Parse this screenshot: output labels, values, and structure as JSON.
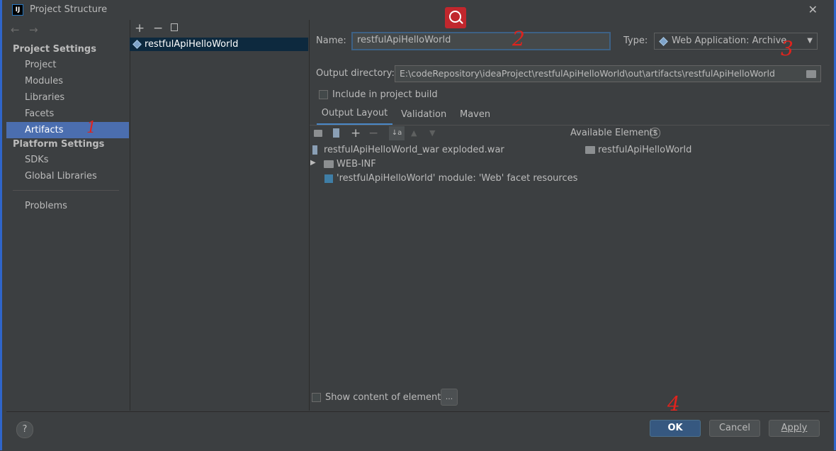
{
  "window": {
    "title": "Project Structure",
    "app_icon": "intellij-icon",
    "close_icon": "close-icon"
  },
  "nav": {
    "back_icon": "arrow-left-icon",
    "forward_icon": "arrow-right-icon"
  },
  "sidebar": {
    "project_settings_header": "Project Settings",
    "project_settings_items": [
      "Project",
      "Modules",
      "Libraries",
      "Facets",
      "Artifacts"
    ],
    "selected": "Artifacts",
    "platform_settings_header": "Platform Settings",
    "platform_settings_items": [
      "SDKs",
      "Global Libraries"
    ],
    "problems": "Problems"
  },
  "artifacts_tree": {
    "toolbar": {
      "add": "+",
      "remove": "−",
      "copy_icon": "copy-icon"
    },
    "items": [
      "restfulApiHelloWorld"
    ]
  },
  "form": {
    "name_label": "Name:",
    "name_value": "restfulApiHelloWorld",
    "type_label": "Type:",
    "type_value": "Web Application: Archive",
    "output_dir_label": "Output directory:",
    "output_dir_value": "E:\\codeRepository\\ideaProject\\restfulApiHelloWorld\\out\\artifacts\\restfulApiHelloWorld",
    "include_label": "Include in project build",
    "include_checked": false
  },
  "tabs": [
    "Output Layout",
    "Validation",
    "Maven"
  ],
  "active_tab": "Output Layout",
  "layout_tree": {
    "items": [
      "restfulApiHelloWorld_war exploded.war",
      "WEB-INF",
      "'restfulApiHelloWorld' module: 'Web' facet resources"
    ]
  },
  "available": {
    "label": "Available Elements",
    "help": "?",
    "items": [
      "restfulApiHelloWorld"
    ]
  },
  "show_content": {
    "label": "Show content of elements",
    "checked": false,
    "ellipsis": "..."
  },
  "footer": {
    "help": "?",
    "ok": "OK",
    "cancel": "Cancel",
    "apply": "Apply"
  },
  "annotations": [
    "1",
    "2",
    "3",
    "4"
  ],
  "colors": {
    "accent": "#4b6eaf",
    "annotation": "#e0231d",
    "background": "#3c3f41"
  }
}
